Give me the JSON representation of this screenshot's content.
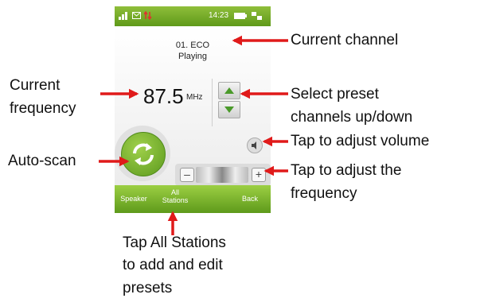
{
  "status_bar": {
    "time": "14:23"
  },
  "radio": {
    "channel": "01. ECO",
    "state": "Playing",
    "frequency": "87.5",
    "unit": "MHz",
    "minus": "–",
    "plus": "+"
  },
  "softkeys": {
    "left": "Speaker",
    "middle_line1": "All",
    "middle_line2": "Stations",
    "right": "Back"
  },
  "callouts": {
    "current_channel": "Current channel",
    "current_frequency_1": "Current",
    "current_frequency_2": "frequency",
    "preset_1": "Select preset",
    "preset_2": "channels up/down",
    "volume": "Tap to adjust volume",
    "adjust_1": "Tap to adjust the",
    "adjust_2": "frequency",
    "autoscan": "Auto-scan",
    "allstations_1": "Tap All Stations",
    "allstations_2": "to add and edit",
    "allstations_3": "presets"
  },
  "colors": {
    "accent_green": "#6aa823",
    "arrow_red": "#e01a1a"
  }
}
